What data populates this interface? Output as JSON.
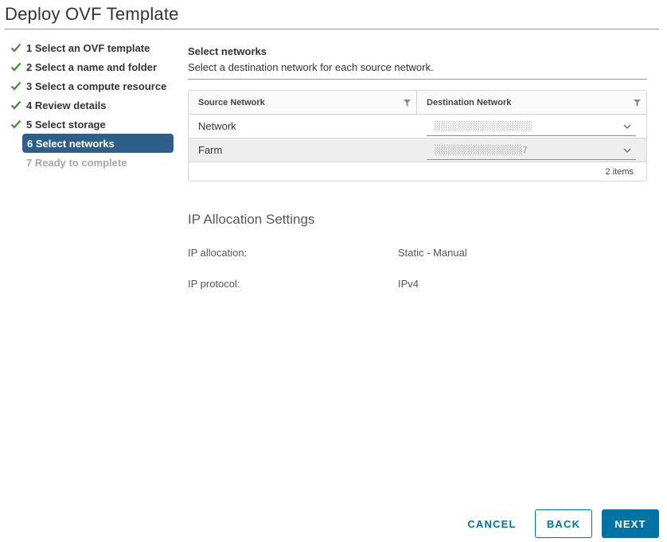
{
  "window": {
    "title": "Deploy OVF Template"
  },
  "steps": [
    {
      "label": "1 Select an OVF template",
      "state": "done"
    },
    {
      "label": "2 Select a name and folder",
      "state": "done"
    },
    {
      "label": "3 Select a compute resource",
      "state": "done"
    },
    {
      "label": "4 Review details",
      "state": "done"
    },
    {
      "label": "5 Select storage",
      "state": "done"
    },
    {
      "label": "6 Select networks",
      "state": "active"
    },
    {
      "label": "7 Ready to complete",
      "state": "disabled"
    }
  ],
  "content": {
    "title": "Select networks",
    "subtitle": "Select a destination network for each source network."
  },
  "grid": {
    "columns": {
      "source": "Source Network",
      "destination": "Destination Network"
    },
    "rows": [
      {
        "source": "Network",
        "destination": "░░░░░░░░░░░░░░░░░░░░"
      },
      {
        "source": "Farm",
        "destination": "░░░░░░░░░░░░░░░░░░7"
      }
    ],
    "footer": "2 items"
  },
  "ip": {
    "title": "IP Allocation Settings",
    "allocation_label": "IP allocation:",
    "allocation_value": "Static - Manual",
    "protocol_label": "IP protocol:",
    "protocol_value": "IPv4"
  },
  "buttons": {
    "cancel": "CANCEL",
    "back": "BACK",
    "next": "NEXT"
  },
  "colors": {
    "accent": "#0072a3",
    "active_step": "#2d5f8a",
    "check": "#3c8d2f"
  }
}
